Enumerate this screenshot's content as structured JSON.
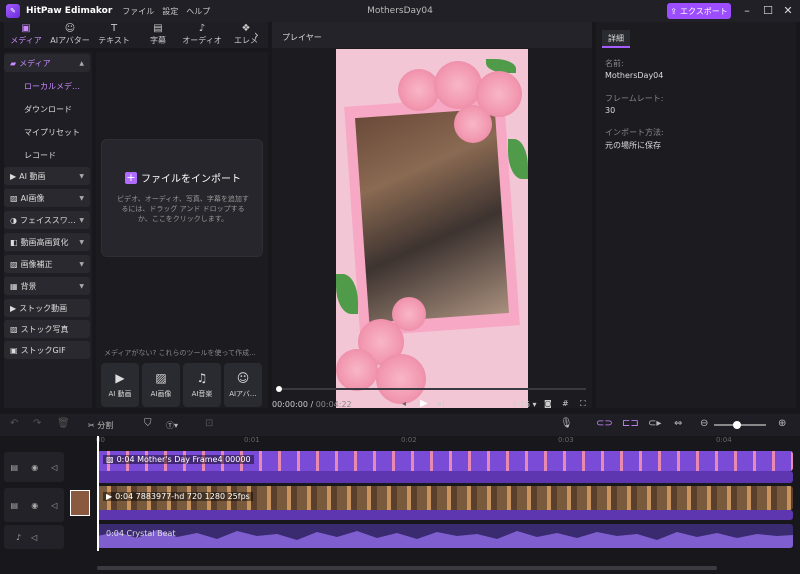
{
  "app": {
    "name": "HitPaw Edimakor",
    "doc_title": "MothersDay04",
    "menu": [
      "ファイル",
      "設定",
      "ヘルプ"
    ],
    "export_label": "エクスポート"
  },
  "tabs": [
    {
      "label": "メディア",
      "icon": "media-icon"
    },
    {
      "label": "AIアバター",
      "icon": "avatar-icon"
    },
    {
      "label": "テキスト",
      "icon": "text-icon"
    },
    {
      "label": "字幕",
      "icon": "subtitle-icon"
    },
    {
      "label": "オーディオ",
      "icon": "audio-icon"
    },
    {
      "label": "エレメ",
      "icon": "element-icon"
    }
  ],
  "sidebar": {
    "media_group": "メディア",
    "sub": [
      "ローカルメデ…",
      "ダウンロード",
      "マイプリセット",
      "レコード"
    ],
    "groups": [
      "AI 動画",
      "AI画像",
      "フェイススワ…",
      "動画高画質化",
      "画像補正",
      "背景",
      "ストック動画",
      "ストック写真",
      "ストックGIF"
    ]
  },
  "import": {
    "title": "ファイルをインポート",
    "desc": "ビデオ、オーディオ、写真、字幕を追加するには、ドラッグ アンド ドロップするか、ここをクリックします。"
  },
  "nomedia": "メディアがない? これらのツールを使って作成...",
  "tools": [
    {
      "label": "AI 動画"
    },
    {
      "label": "AI画像"
    },
    {
      "label": "AI音楽"
    },
    {
      "label": "AIアバ…"
    }
  ],
  "player": {
    "header": "プレイヤー",
    "time_current": "00:00:00",
    "time_total": "00:04:22",
    "aspect": "9:16"
  },
  "details": {
    "tab": "詳細",
    "name_label": "名前:",
    "name_value": "MothersDay04",
    "framerate_label": "フレームレート:",
    "framerate_value": "30",
    "import_label": "インポート方法:",
    "import_value": "元の場所に保存"
  },
  "timeline": {
    "split_label": "分割",
    "ruler": [
      "00",
      "0:01",
      "0:02",
      "0:03",
      "0:04"
    ],
    "clip1": "0:04 Mother's Day Frame4 00000",
    "clip2": "0:04 7883977-hd 720 1280 25fps",
    "audio": "0:04 Crystal Beat"
  }
}
